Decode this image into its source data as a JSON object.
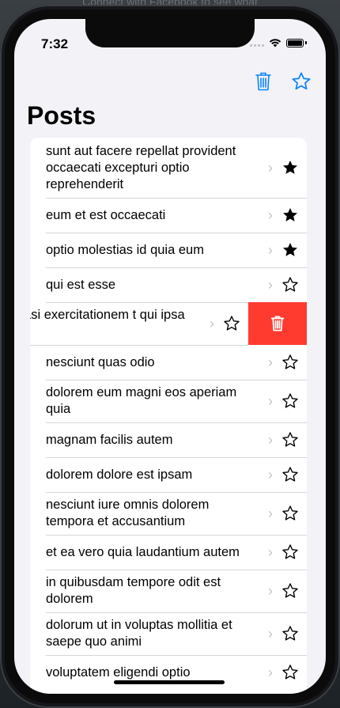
{
  "background": {
    "banner_text": "Connect with Facebook to see what"
  },
  "status_bar": {
    "time": "7:32"
  },
  "nav": {
    "title": "Posts",
    "trash_icon": "trash-icon",
    "star_icon": "star-outline-icon",
    "accent": "#0a84ff"
  },
  "rows": [
    {
      "text": "sunt aut facere repellat provident occaecati excepturi optio reprehenderit",
      "starred": true
    },
    {
      "text": "eum et est occaecati",
      "starred": true
    },
    {
      "text": "optio molestias id quia eum",
      "starred": true
    },
    {
      "text": "qui est esse",
      "starred": false
    },
    {
      "text": "estias quasi exercitationem t qui ipsa sit aut",
      "starred": false,
      "swiped": true
    },
    {
      "text": "nesciunt quas odio",
      "starred": false
    },
    {
      "text": "dolorem eum magni eos aperiam quia",
      "starred": false
    },
    {
      "text": "magnam facilis autem",
      "starred": false
    },
    {
      "text": "dolorem dolore est ipsam",
      "starred": false
    },
    {
      "text": "nesciunt iure omnis dolorem tempora et accusantium",
      "starred": false
    },
    {
      "text": "et ea vero quia laudantium autem",
      "starred": false
    },
    {
      "text": "in quibusdam tempore odit est dolorem",
      "starred": false
    },
    {
      "text": "dolorum ut in voluptas mollitia et saepe quo animi",
      "starred": false
    },
    {
      "text": "voluptatem eligendi optio",
      "starred": false
    }
  ],
  "row_chevron": "›",
  "swipe_action": {
    "icon": "trash-icon",
    "color": "#ff3b30"
  }
}
